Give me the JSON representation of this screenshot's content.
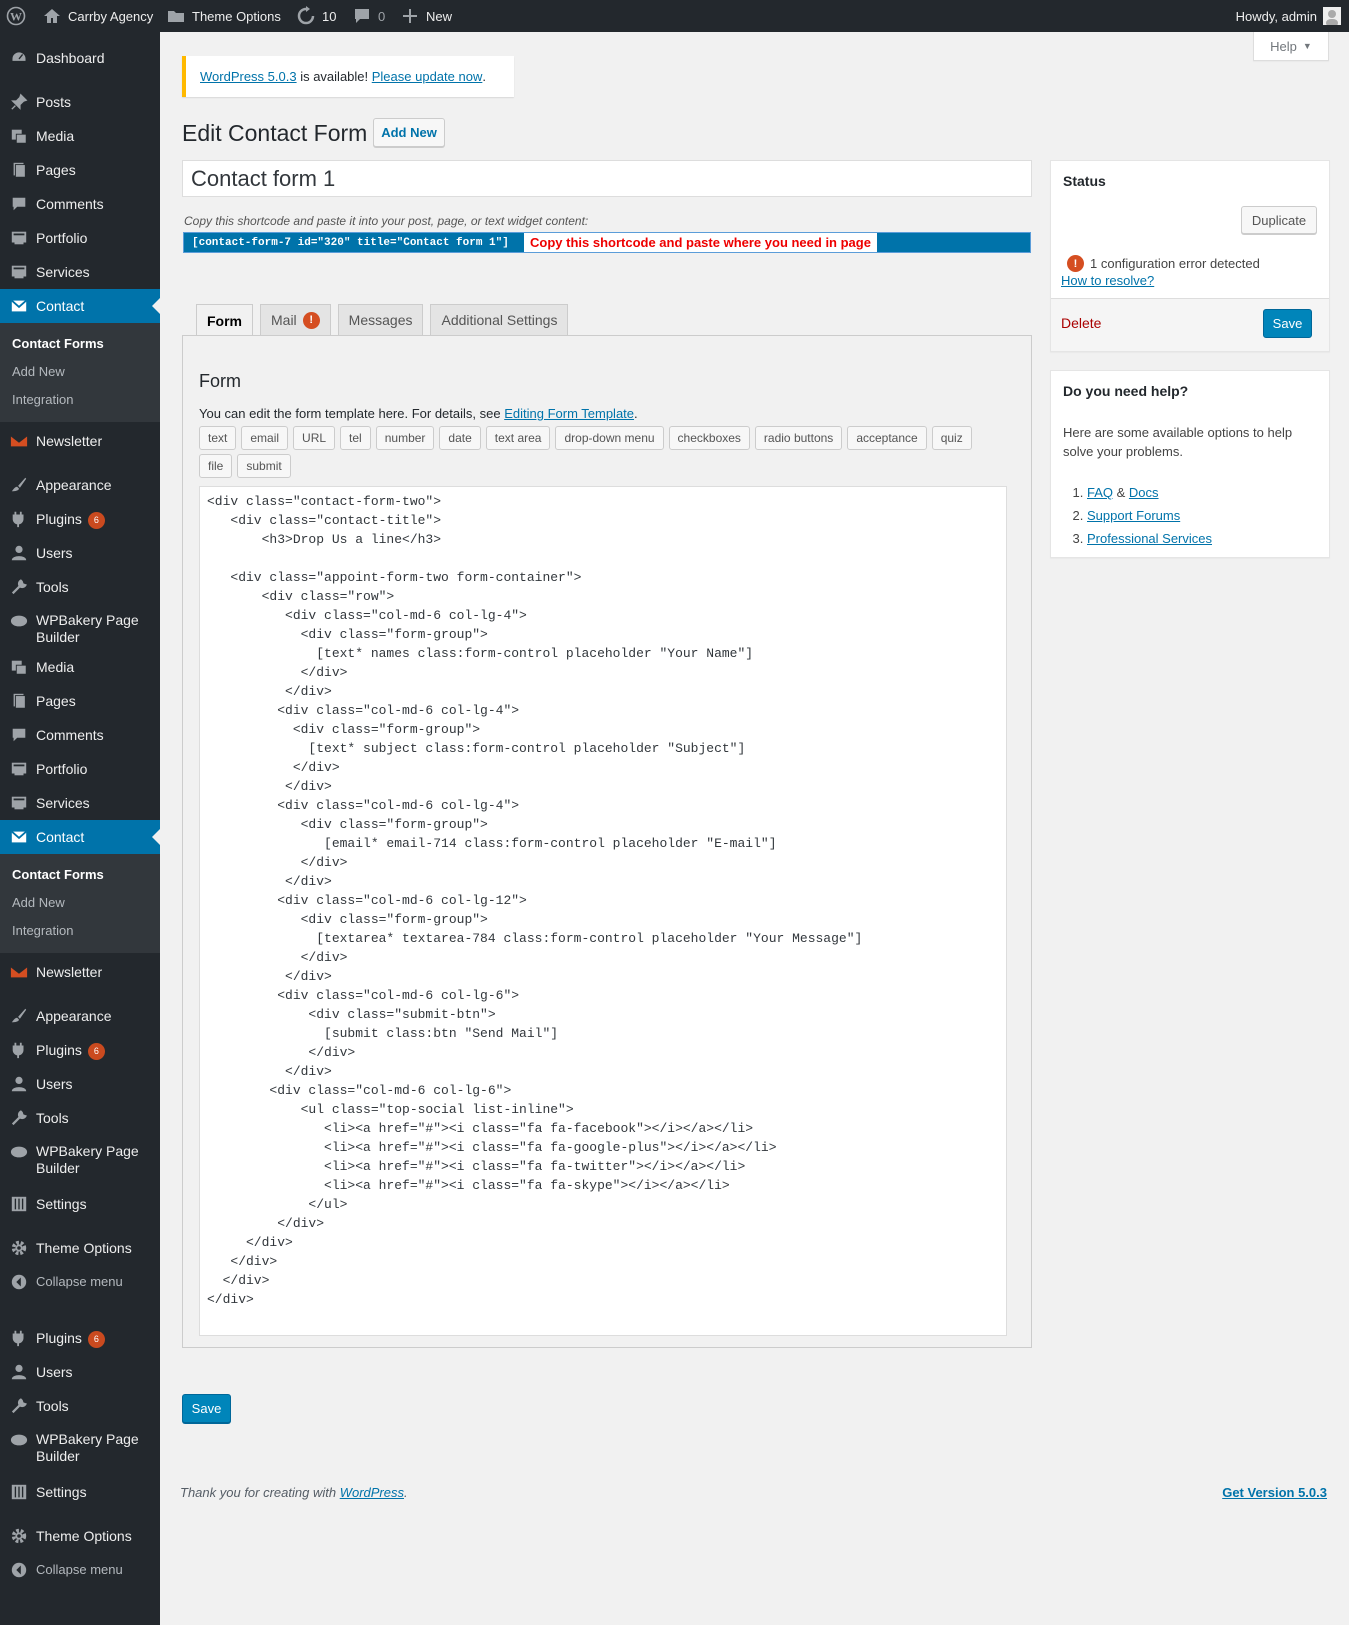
{
  "adminbar": {
    "site_name": "Carrby Agency",
    "theme_options": "Theme Options",
    "updates_count": "10",
    "comments_count": "0",
    "new_label": "New",
    "howdy": "Howdy, admin"
  },
  "sidebar": {
    "dashboard": "Dashboard",
    "posts": "Posts",
    "media": "Media",
    "pages": "Pages",
    "comments": "Comments",
    "portfolio": "Portfolio",
    "services": "Services",
    "contact": "Contact",
    "contact_forms": "Contact Forms",
    "add_new": "Add New",
    "integration": "Integration",
    "newsletter": "Newsletter",
    "appearance": "Appearance",
    "plugins": "Plugins",
    "plugins_badge": "6",
    "users": "Users",
    "tools": "Tools",
    "wpbakery": "WPBakery Page Builder",
    "settings": "Settings",
    "theme_options": "Theme Options",
    "collapse": "Collapse menu"
  },
  "help_tab": "Help",
  "notice": {
    "link1": "WordPress 5.0.3",
    "text": " is available! ",
    "link2": "Please update now",
    "end": "."
  },
  "page_title": "Edit Contact Form",
  "add_new_button": "Add New",
  "form_title_value": "Contact form 1",
  "shortcode": {
    "label": "Copy this shortcode and paste it into your post, page, or text widget content:",
    "code": "[contact-form-7 id=\"320\" title=\"Contact form 1\"]",
    "hint": "Copy this shortcode and paste where you need in page"
  },
  "tabs": [
    "Form",
    "Mail",
    "Messages",
    "Additional Settings"
  ],
  "panel": {
    "heading": "Form",
    "desc_text": "You can edit the form template here. For details, see ",
    "desc_link": "Editing Form Template",
    "desc_end": ".",
    "tags": [
      "text",
      "email",
      "URL",
      "tel",
      "number",
      "date",
      "text area",
      "drop-down menu",
      "checkboxes",
      "radio buttons",
      "acceptance",
      "quiz",
      "file",
      "submit"
    ],
    "code": "<div class=\"contact-form-two\">\n   <div class=\"contact-title\">\n       <h3>Drop Us a line</h3>\n\n   <div class=\"appoint-form-two form-container\">\n       <div class=\"row\">\n          <div class=\"col-md-6 col-lg-4\">\n            <div class=\"form-group\">\n              [text* names class:form-control placeholder \"Your Name\"]\n            </div>\n          </div>\n         <div class=\"col-md-6 col-lg-4\">\n           <div class=\"form-group\">\n             [text* subject class:form-control placeholder \"Subject\"]\n           </div>\n          </div>\n         <div class=\"col-md-6 col-lg-4\">\n            <div class=\"form-group\">\n               [email* email-714 class:form-control placeholder \"E-mail\"]\n            </div>\n          </div>\n         <div class=\"col-md-6 col-lg-12\">\n            <div class=\"form-group\">\n              [textarea* textarea-784 class:form-control placeholder \"Your Message\"]\n            </div>\n          </div>\n         <div class=\"col-md-6 col-lg-6\">\n             <div class=\"submit-btn\">\n               [submit class:btn \"Send Mail\"]\n             </div>\n          </div>\n        <div class=\"col-md-6 col-lg-6\">\n            <ul class=\"top-social list-inline\">\n               <li><a href=\"#\"><i class=\"fa fa-facebook\"></i></a></li>\n               <li><a href=\"#\"><i class=\"fa fa-google-plus\"></i></a></li>\n               <li><a href=\"#\"><i class=\"fa fa-twitter\"></i></a></li>\n               <li><a href=\"#\"><i class=\"fa fa-skype\"></i></a></li>\n             </ul>\n         </div>\n     </div>\n   </div>\n  </div>\n</div>"
  },
  "save_label": "Save",
  "status": {
    "title": "Status",
    "duplicate": "Duplicate",
    "error": "1 configuration error detected",
    "resolve": "How to resolve?",
    "delete": "Delete",
    "save": "Save"
  },
  "helpbox": {
    "title": "Do you need help?",
    "text": "Here are some available options to help solve your problems.",
    "faq": "FAQ",
    "amp": " & ",
    "docs": "Docs",
    "forums": "Support Forums",
    "services": "Professional Services"
  },
  "footer": {
    "text": "Thank you for creating with ",
    "link": "WordPress",
    "end": ".",
    "version": "Get Version 5.0.3"
  },
  "colors": {
    "adminbar": "#23282d",
    "accent": "#0073aa",
    "error": "#d54e21",
    "hint_text": "#ee0000"
  }
}
